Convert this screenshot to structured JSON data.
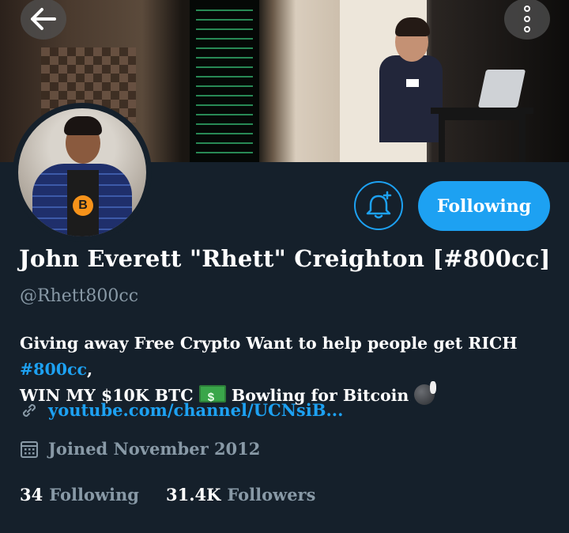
{
  "header": {
    "back_icon": "arrow-left-icon",
    "more_icon": "more-vertical-icon"
  },
  "profile": {
    "display_name": "John Everett \"Rhett\" Creighton [#800cc]",
    "handle": "@Rhett800cc",
    "bio": {
      "line1_text": "Giving away Free Crypto Want to help people get RICH ",
      "line1_hashtag": "#800cc",
      "line1_end": ",",
      "line2_a": "WIN MY $10K BTC ",
      "line2_b": " Bowling for Bitcoin "
    },
    "link": "youtube.com/channel/UCNsiB...",
    "joined": "Joined November 2012",
    "following_count": "34",
    "following_label": "Following",
    "followers_count": "31.4K",
    "followers_label": "Followers"
  },
  "actions": {
    "notify_icon": "bell-plus-icon",
    "following_button": "Following"
  },
  "colors": {
    "background": "#15202b",
    "accent": "#1da1f2",
    "muted": "#8899a6"
  }
}
